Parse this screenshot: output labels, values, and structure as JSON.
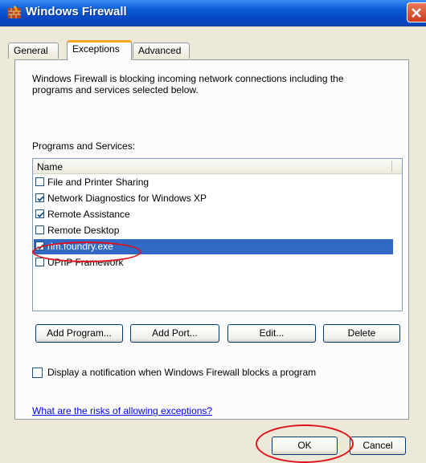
{
  "window": {
    "title": "Windows Firewall"
  },
  "tabs": [
    {
      "label": "General"
    },
    {
      "label": "Exceptions"
    },
    {
      "label": "Advanced"
    }
  ],
  "active_tab": "Exceptions",
  "exceptions": {
    "description": "Windows Firewall is blocking incoming network connections including the programs and services selected below.",
    "programs_label": "Programs and Services:",
    "column_header": "Name",
    "items": [
      {
        "label": "File and Printer Sharing",
        "checked": false,
        "selected": false
      },
      {
        "label": "Network Diagnostics for Windows XP",
        "checked": true,
        "selected": false
      },
      {
        "label": "Remote Assistance",
        "checked": true,
        "selected": false
      },
      {
        "label": "Remote Desktop",
        "checked": false,
        "selected": false
      },
      {
        "label": "rlm.foundry.exe",
        "checked": true,
        "selected": true
      },
      {
        "label": "UPnP Framework",
        "checked": false,
        "selected": false
      }
    ],
    "buttons": {
      "add_program": "Add Program...",
      "add_port": "Add Port...",
      "edit": "Edit...",
      "delete": "Delete"
    },
    "notify_label": "Display a notification when Windows Firewall blocks a program",
    "notify_checked": false,
    "risks_link": "What are the risks of allowing exceptions?"
  },
  "footer": {
    "ok": "OK",
    "cancel": "Cancel"
  },
  "colors": {
    "titlebar": "#0a5fd8",
    "selection": "#316ac5",
    "highlight_ellipse": "#e0101e",
    "link": "#0000ff"
  }
}
